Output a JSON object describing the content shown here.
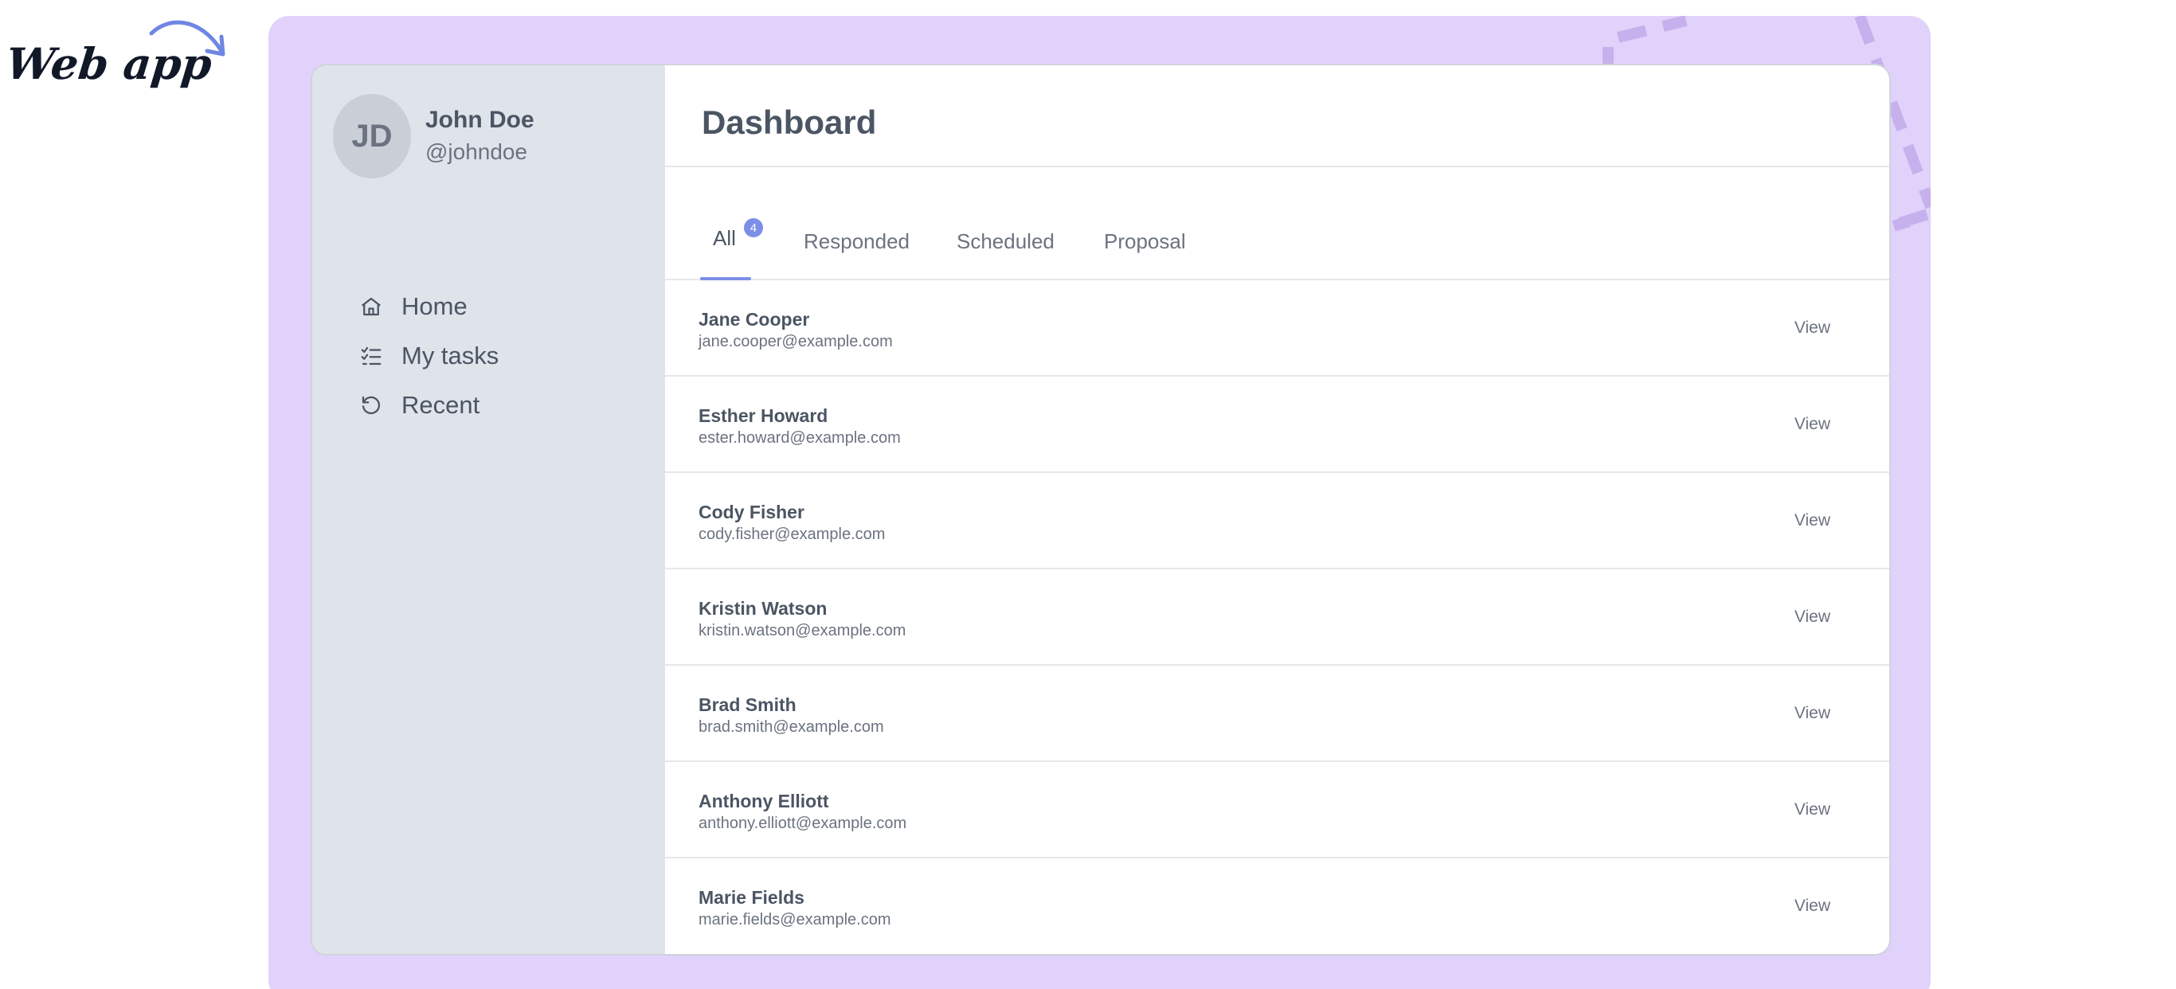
{
  "caption": "Web app",
  "user": {
    "initials": "JD",
    "name": "John Doe",
    "handle": "@johndoe"
  },
  "nav": [
    {
      "label": "Home",
      "icon": "home-icon"
    },
    {
      "label": "My tasks",
      "icon": "tasks-icon"
    },
    {
      "label": "Recent",
      "icon": "history-icon"
    }
  ],
  "page_title": "Dashboard",
  "tabs": [
    {
      "label": "All",
      "badge": "4",
      "active": true
    },
    {
      "label": "Responded"
    },
    {
      "label": "Scheduled"
    },
    {
      "label": "Proposal"
    }
  ],
  "rows": [
    {
      "name": "Jane Cooper",
      "email": "jane.cooper@example.com",
      "action": "View"
    },
    {
      "name": "Esther Howard",
      "email": "ester.howard@example.com",
      "action": "View"
    },
    {
      "name": "Cody Fisher",
      "email": "cody.fisher@example.com",
      "action": "View"
    },
    {
      "name": "Kristin Watson",
      "email": "kristin.watson@example.com",
      "action": "View"
    },
    {
      "name": "Brad Smith",
      "email": "brad.smith@example.com",
      "action": "View"
    },
    {
      "name": "Anthony Elliott",
      "email": "anthony.elliott@example.com",
      "action": "View"
    },
    {
      "name": "Marie Fields",
      "email": "marie.fields@example.com",
      "action": "View"
    }
  ],
  "colors": {
    "backdrop": "#e1d2fb",
    "sidebar": "#dfe3ea",
    "accent": "#7c8fe6",
    "text": "#4b5563",
    "muted": "#6b7280"
  }
}
